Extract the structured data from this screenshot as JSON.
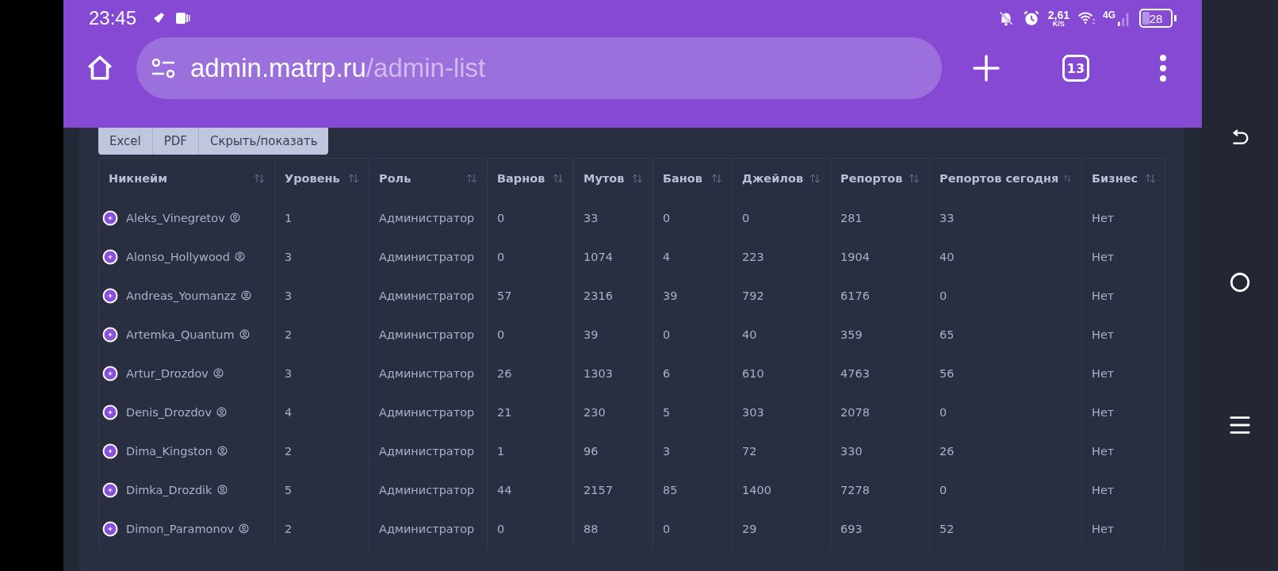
{
  "status_bar": {
    "time": "23:45",
    "speed": "2,61",
    "speed_unit": "K/S",
    "network": "4G",
    "battery": "28"
  },
  "browser": {
    "url_host": "admin.matrp.ru",
    "url_path": "/admin-list",
    "tab_count": "13"
  },
  "toolbar": [
    "Excel",
    "PDF",
    "Скрыть/показать"
  ],
  "table": {
    "columns": [
      "Никнейм",
      "Уровень",
      "Роль",
      "Варнов",
      "Мутов",
      "Банов",
      "Джейлов",
      "Репортов",
      "Репортов сегодня",
      "Бизнес"
    ],
    "rows": [
      [
        "Aleks_Vinegretov",
        "1",
        "Администратор",
        "0",
        "33",
        "0",
        "0",
        "281",
        "33",
        "Нет"
      ],
      [
        "Alonso_Hollywood",
        "3",
        "Администратор",
        "0",
        "1074",
        "4",
        "223",
        "1904",
        "40",
        "Нет"
      ],
      [
        "Andreas_Youmanzz",
        "3",
        "Администратор",
        "57",
        "2316",
        "39",
        "792",
        "6176",
        "0",
        "Нет"
      ],
      [
        "Artemka_Quantum",
        "2",
        "Администратор",
        "0",
        "39",
        "0",
        "40",
        "359",
        "65",
        "Нет"
      ],
      [
        "Artur_Drozdov",
        "3",
        "Администратор",
        "26",
        "1303",
        "6",
        "610",
        "4763",
        "56",
        "Нет"
      ],
      [
        "Denis_Drozdov",
        "4",
        "Администратор",
        "21",
        "230",
        "5",
        "303",
        "2078",
        "0",
        "Нет"
      ],
      [
        "Dima_Kingston",
        "2",
        "Администратор",
        "1",
        "96",
        "3",
        "72",
        "330",
        "26",
        "Нет"
      ],
      [
        "Dimka_Drozdik",
        "5",
        "Администратор",
        "44",
        "2157",
        "85",
        "1400",
        "7278",
        "0",
        "Нет"
      ],
      [
        "Dimon_Paramonov",
        "2",
        "Администратор",
        "0",
        "88",
        "0",
        "29",
        "693",
        "52",
        "Нет"
      ]
    ]
  }
}
